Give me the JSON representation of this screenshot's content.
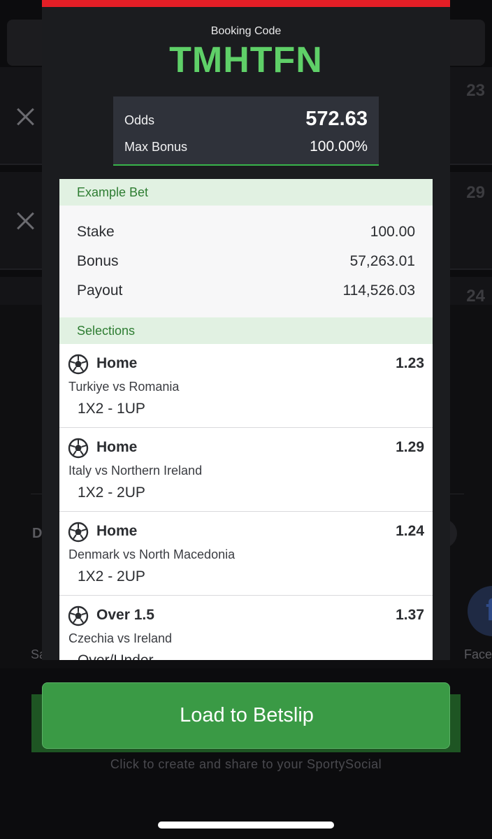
{
  "background": {
    "rows": [
      {
        "odd": "23"
      },
      {
        "odd": "29"
      },
      {
        "odd": "24"
      }
    ],
    "section_letter": "D",
    "share_left_label": "Sa",
    "share_right_label": "Face",
    "hint": "Click to create and share to your SportySocial"
  },
  "modal": {
    "booking_label": "Booking Code",
    "booking_code": "TMHTFN",
    "odds_label": "Odds",
    "odds_value": "572.63",
    "max_bonus_label": "Max Bonus",
    "max_bonus_value": "100.00%",
    "example_bet": {
      "heading": "Example Bet",
      "stake_label": "Stake",
      "stake_value": "100.00",
      "bonus_label": "Bonus",
      "bonus_value": "57,263.01",
      "payout_label": "Payout",
      "payout_value": "114,526.03"
    },
    "selections_heading": "Selections",
    "selections": [
      {
        "pick": "Home",
        "odd": "1.23",
        "match": "Turkiye vs Romania",
        "market": "1X2 - 1UP",
        "icon": "soccer-ball-icon"
      },
      {
        "pick": "Home",
        "odd": "1.29",
        "match": "Italy vs Northern Ireland",
        "market": "1X2 - 2UP",
        "icon": "soccer-ball-icon"
      },
      {
        "pick": "Home",
        "odd": "1.24",
        "match": "Denmark vs North Macedonia",
        "market": "1X2 - 2UP",
        "icon": "soccer-ball-icon"
      },
      {
        "pick": "Over 1.5",
        "odd": "1.37",
        "match": "Czechia vs Ireland",
        "market": "Over/Under",
        "icon": "soccer-ball-icon"
      }
    ]
  },
  "load_button_label": "Load to Betslip",
  "colors": {
    "accent_green": "#5fd068",
    "button_green": "#3a9a45",
    "top_bar_red": "#e41e26",
    "section_header_bg": "#e1f1e2"
  }
}
